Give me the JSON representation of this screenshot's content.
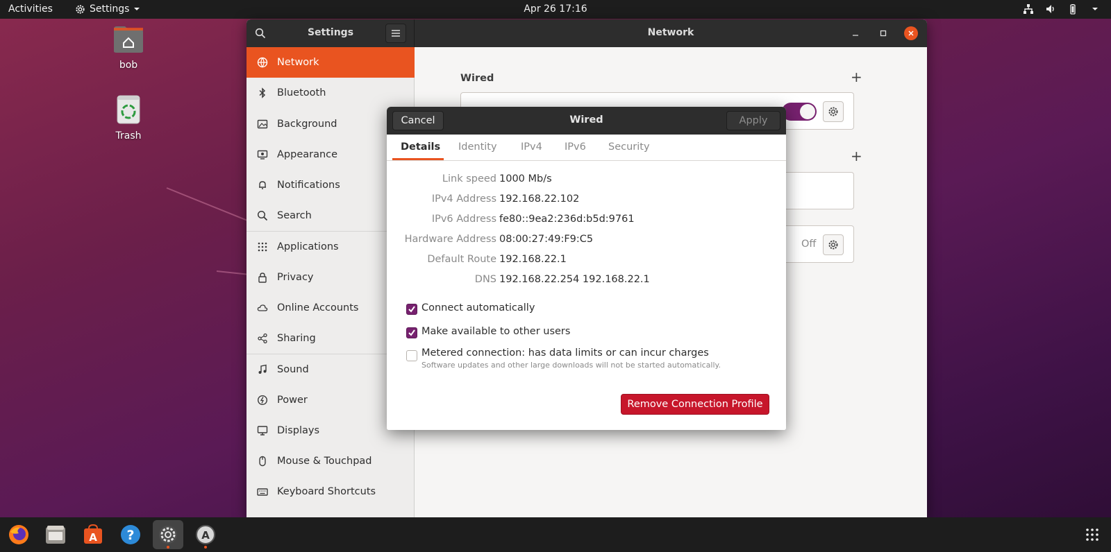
{
  "topbar": {
    "activities": "Activities",
    "app_menu": "Settings",
    "clock": "Apr 26  17:16"
  },
  "desktop": {
    "home_label": "bob",
    "trash_label": "Trash"
  },
  "window": {
    "sidebar_title": "Settings",
    "content_title": "Network",
    "sidebar_items": [
      {
        "label": "Network",
        "icon": "network-icon"
      },
      {
        "label": "Bluetooth",
        "icon": "bluetooth-icon"
      },
      {
        "label": "Background",
        "icon": "background-icon"
      },
      {
        "label": "Appearance",
        "icon": "appearance-icon"
      },
      {
        "label": "Notifications",
        "icon": "bell-icon"
      },
      {
        "label": "Search",
        "icon": "search-icon"
      },
      {
        "label": "Applications",
        "icon": "grid-icon"
      },
      {
        "label": "Privacy",
        "icon": "lock-icon"
      },
      {
        "label": "Online Accounts",
        "icon": "cloud-icon"
      },
      {
        "label": "Sharing",
        "icon": "share-icon"
      },
      {
        "label": "Sound",
        "icon": "music-note-icon"
      },
      {
        "label": "Power",
        "icon": "power-icon"
      },
      {
        "label": "Displays",
        "icon": "display-icon"
      },
      {
        "label": "Mouse & Touchpad",
        "icon": "mouse-icon"
      },
      {
        "label": "Keyboard Shortcuts",
        "icon": "keyboard-icon"
      }
    ],
    "network": {
      "wired_title": "Wired",
      "proxy_status": "Off"
    }
  },
  "dialog": {
    "title": "Wired",
    "cancel_label": "Cancel",
    "apply_label": "Apply",
    "tabs": [
      "Details",
      "Identity",
      "IPv4",
      "IPv6",
      "Security"
    ],
    "details": {
      "rows": [
        {
          "label": "Link speed",
          "value": "1000 Mb/s"
        },
        {
          "label": "IPv4 Address",
          "value": "192.168.22.102"
        },
        {
          "label": "IPv6 Address",
          "value": "fe80::9ea2:236d:b5d:9761"
        },
        {
          "label": "Hardware Address",
          "value": "08:00:27:49:F9:C5"
        },
        {
          "label": "Default Route",
          "value": "192.168.22.1"
        },
        {
          "label": "DNS",
          "value": "192.168.22.254 192.168.22.1"
        }
      ],
      "connect_automatically": "Connect automatically",
      "make_available": "Make available to other users",
      "metered": "Metered connection: has data limits or can incur charges",
      "metered_sub": "Software updates and other large downloads will not be started automatically.",
      "remove_label": "Remove Connection Profile"
    }
  },
  "colors": {
    "accent": "#e95420",
    "toggle_on": "#77216f",
    "destructive": "#c7162b"
  }
}
